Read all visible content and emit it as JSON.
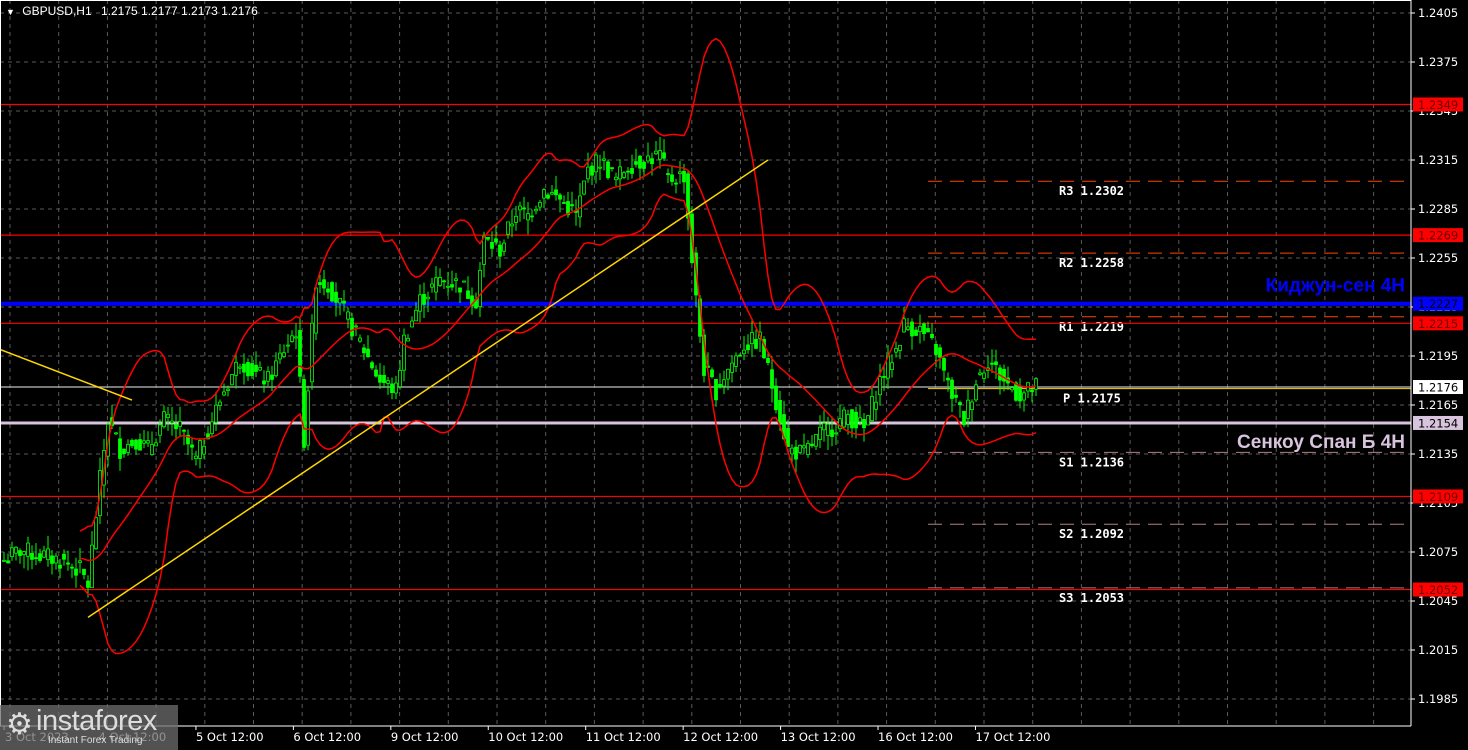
{
  "header": {
    "symbol": "GBPUSD,H1",
    "ohlc": "1.2175 1.2177 1.2173 1.2176"
  },
  "chart_data": {
    "type": "candlestick",
    "title": "GBPUSD,H1",
    "ylim": [
      1.1985,
      1.2405
    ],
    "y_ticks": [
      "1.2405",
      "1.2375",
      "1.2345",
      "1.2315",
      "1.2285",
      "1.2255",
      "1.2225",
      "1.2195",
      "1.2165",
      "1.2135",
      "1.2105",
      "1.2075",
      "1.2045",
      "1.2015",
      "1.1985"
    ],
    "x_ticks": [
      {
        "bar": 1,
        "label": "3 Oct 2023"
      },
      {
        "bar": 25,
        "label": "4 Oct 12:00"
      },
      {
        "bar": 49,
        "label": "5 Oct 12:00"
      },
      {
        "bar": 73,
        "label": "6 Oct 12:00"
      },
      {
        "bar": 97,
        "label": "9 Oct 12:00"
      },
      {
        "bar": 121,
        "label": "10 Oct 12:00"
      },
      {
        "bar": 145,
        "label": "11 Oct 12:00"
      },
      {
        "bar": 169,
        "label": "12 Oct 12:00"
      },
      {
        "bar": 193,
        "label": "13 Oct 12:00"
      },
      {
        "bar": 217,
        "label": "16 Oct 12:00"
      },
      {
        "bar": 241,
        "label": "17 Oct 12:00"
      }
    ],
    "close_path": [
      [
        1,
        1.207
      ],
      [
        5,
        1.2076
      ],
      [
        10,
        1.2073
      ],
      [
        15,
        1.207
      ],
      [
        20,
        1.2064
      ],
      [
        22,
        1.2055
      ],
      [
        25,
        1.2119
      ],
      [
        27,
        1.2156
      ],
      [
        30,
        1.2138
      ],
      [
        34,
        1.2144
      ],
      [
        37,
        1.2138
      ],
      [
        41,
        1.2156
      ],
      [
        45,
        1.215
      ],
      [
        49,
        1.2131
      ],
      [
        52,
        1.215
      ],
      [
        56,
        1.2174
      ],
      [
        60,
        1.2193
      ],
      [
        64,
        1.2184
      ],
      [
        67,
        1.218
      ],
      [
        71,
        1.2199
      ],
      [
        74,
        1.2211
      ],
      [
        76,
        1.2144
      ],
      [
        79,
        1.2242
      ],
      [
        82,
        1.2239
      ],
      [
        87,
        1.2217
      ],
      [
        91,
        1.2199
      ],
      [
        95,
        1.218
      ],
      [
        99,
        1.2174
      ],
      [
        101,
        1.2205
      ],
      [
        105,
        1.2229
      ],
      [
        110,
        1.2242
      ],
      [
        115,
        1.2239
      ],
      [
        119,
        1.2229
      ],
      [
        121,
        1.2266
      ],
      [
        125,
        1.226
      ],
      [
        129,
        1.2284
      ],
      [
        132,
        1.2281
      ],
      [
        136,
        1.2297
      ],
      [
        140,
        1.2291
      ],
      [
        144,
        1.2281
      ],
      [
        147,
        1.2309
      ],
      [
        150,
        1.2315
      ],
      [
        154,
        1.2303
      ],
      [
        157,
        1.2312
      ],
      [
        161,
        1.2315
      ],
      [
        165,
        1.2318
      ],
      [
        167,
        1.2303
      ],
      [
        171,
        1.2306
      ],
      [
        174,
        1.2229
      ],
      [
        176,
        1.2187
      ],
      [
        179,
        1.2174
      ],
      [
        182,
        1.2187
      ],
      [
        186,
        1.2202
      ],
      [
        190,
        1.2205
      ],
      [
        194,
        1.2168
      ],
      [
        197,
        1.2138
      ],
      [
        201,
        1.2135
      ],
      [
        205,
        1.2147
      ],
      [
        209,
        1.2153
      ],
      [
        212,
        1.2159
      ],
      [
        216,
        1.215
      ],
      [
        220,
        1.218
      ],
      [
        224,
        1.2199
      ],
      [
        226,
        1.2214
      ],
      [
        230,
        1.2211
      ],
      [
        234,
        1.2199
      ],
      [
        237,
        1.2177
      ],
      [
        241,
        1.2156
      ],
      [
        244,
        1.218
      ],
      [
        247,
        1.2193
      ],
      [
        251,
        1.218
      ],
      [
        255,
        1.2171
      ],
      [
        259,
        1.2176
      ]
    ],
    "indicators": {
      "bollinger": {
        "period": 20,
        "deviation": 2,
        "color": "#ff0000"
      }
    },
    "trendlines": [
      {
        "from": [
          22,
          1.2035
        ],
        "to": [
          192,
          1.2315
        ],
        "color": "#ffd700"
      },
      {
        "from": [
          0,
          1.2199
        ],
        "to": [
          33,
          1.2168
        ],
        "color": "#ffd700"
      }
    ],
    "levels": [
      {
        "price": 1.2349,
        "label": "1.2349",
        "color": "#ff0000",
        "kind": "red"
      },
      {
        "price": 1.2269,
        "label": "1.2269",
        "color": "#ff0000",
        "kind": "red"
      },
      {
        "price": 1.2227,
        "label": "1.2227",
        "color": "#0000ff",
        "kind": "blue"
      },
      {
        "price": 1.2215,
        "label": "1.2215",
        "color": "#ff0000",
        "kind": "red"
      },
      {
        "price": 1.2176,
        "label": "1.2176",
        "color": "#c0c0c0",
        "kind": "price"
      },
      {
        "price": 1.2154,
        "label": "1.2154",
        "color": "#d8c4dc",
        "kind": "pink"
      },
      {
        "price": 1.2109,
        "label": "1.2109",
        "color": "#ff0000",
        "kind": "red"
      },
      {
        "price": 1.2052,
        "label": "1.2052",
        "color": "#ff0000",
        "kind": "red"
      }
    ],
    "pivots": [
      {
        "name": "R3",
        "price": 1.2302,
        "label": "R3 1.2302"
      },
      {
        "name": "R2",
        "price": 1.2258,
        "label": "R2 1.2258"
      },
      {
        "name": "R1",
        "price": 1.2219,
        "label": "R1 1.2219"
      },
      {
        "name": "P",
        "price": 1.2175,
        "label": "P 1.2175"
      },
      {
        "name": "S1",
        "price": 1.2136,
        "label": "S1 1.2136"
      },
      {
        "name": "S2",
        "price": 1.2092,
        "label": "S2 1.2092"
      },
      {
        "name": "S3",
        "price": 1.2053,
        "label": "S3 1.2053"
      }
    ],
    "annotations": [
      {
        "text": "Киджун-сен 4H",
        "price": 1.2227,
        "color": "#0000ff"
      },
      {
        "text": "Сенкоу Спан Б 4H",
        "price": 1.2154,
        "color": "#d8c4dc"
      }
    ]
  },
  "watermark": {
    "brand": "instaforex",
    "tagline": "Instant Forex Trading"
  }
}
